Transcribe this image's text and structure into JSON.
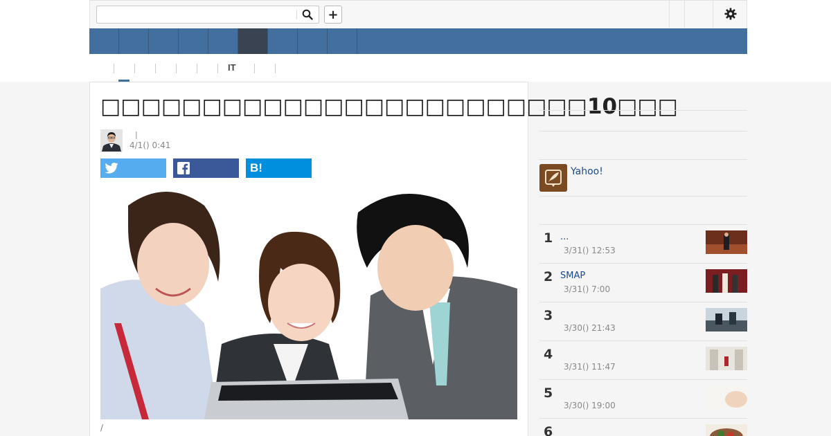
{
  "search": {
    "value": "",
    "placeholder": ""
  },
  "header": {
    "add_label": "+"
  },
  "subnav": {
    "it_label": "IT"
  },
  "article": {
    "headline": "□□□□□□□□□□□□□□□□□□□□□□□□10□□□",
    "author_sep": "|",
    "date": "4/1() 0:41",
    "share_hatena": "B!",
    "caption": "/"
  },
  "sidebar": {
    "promo": {
      "label": "Yahoo!"
    },
    "ranking": [
      {
        "num": "1",
        "title": "...",
        "time": "3/31() 12:53"
      },
      {
        "num": "2",
        "title": "SMAP",
        "time": "3/31() 7:00"
      },
      {
        "num": "3",
        "title": "",
        "time": "3/30() 21:43"
      },
      {
        "num": "4",
        "title": "",
        "time": "3/31() 11:47"
      },
      {
        "num": "5",
        "title": "",
        "time": "3/30() 19:00"
      },
      {
        "num": "6",
        "title": "",
        "time": ""
      }
    ]
  },
  "colors": {
    "nav": "#436f9e",
    "nav_active": "#3a4352",
    "twitter": "#55acee",
    "facebook": "#3b5998",
    "hatena": "#008fde",
    "link": "#1a4a8c"
  },
  "icons": [
    "search-icon",
    "plus-icon",
    "gear-icon",
    "twitter-icon",
    "facebook-icon",
    "hatena-icon",
    "quill-icon"
  ]
}
